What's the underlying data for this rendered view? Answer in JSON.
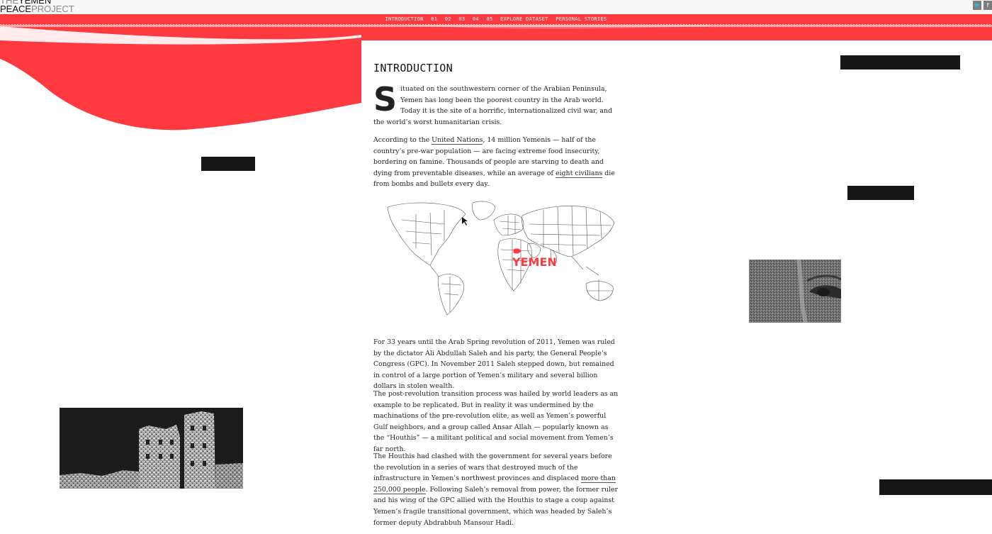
{
  "header": {
    "logo_line1_thin": "THE",
    "logo_line1_bold": "YEMEN",
    "logo_line2_bold": "PEACE",
    "logo_line2_thin": "PROJECT",
    "share_twitter_icon": "twitter-icon",
    "share_facebook_icon": "facebook-icon",
    "share_twitter_glyph": "🐦",
    "share_facebook_glyph": "f"
  },
  "nav": {
    "items": [
      "INTRODUCTION",
      "01",
      "02",
      "03",
      "04",
      "05",
      "EXPLORE DATASET",
      "PERSONAL STORIES"
    ]
  },
  "colors": {
    "accent_red": "#ff3940",
    "dark_block": "#161616"
  },
  "article": {
    "heading": "INTRODUCTION",
    "p1_dropcap": "S",
    "p1_text": "ituated on the southwestern corner of the Arabian Peninsula, Yemen has long been the poorest country in the Arab world. Today it is the site of a horrific, internationalized civil war, and the world’s worst humanitarian crisis.",
    "p2_a": "According to the ",
    "p2_link1": "United Nations",
    "p2_b": ", 14 million Yemenis — half of the country’s pre-war population — are facing extreme food insecurity, bordering on famine. Thousands of people are starving to death and dying from preventable diseases, while an average of ",
    "p2_link2": "eight civilians",
    "p2_c": " die from bombs and bullets every day.",
    "map_label": "YEMEN",
    "p3": "For 33 years until the Arab Spring revolution of 2011, Yemen was ruled by the dictator Ali Abdullah Saleh and his party, the General People’s Congress (GPC). In November 2011 Saleh stepped down, but remained in control of a large portion of Yemen’s military and several billion dollars in stolen wealth.",
    "p4": "The post-revolution transition process was hailed by world leaders as an example to be replicated. But in reality it was undermined by the machinations of the pre-revolution elite, as well as Yemen’s powerful Gulf neighbors, and a group called Ansar Allah — popularly known as the “Houthis” — a militant political and social movement from Yemen’s far north.",
    "p5_a": "The Houthis had clashed with the government for several years before the revolution in a series of wars that destroyed much of the infrastructure in Yemen’s northwest provinces and displaced ",
    "p5_link": "more than 250,000 people",
    "p5_b": ". Following Saleh’s removal from power, the former ruler and his wing of the GPC allied with the Houthis to stage a coup against Yemen’s fragile transitional government, which was headed by Saleh’s former deputy Abdrabbuh Mansour Hadi."
  }
}
